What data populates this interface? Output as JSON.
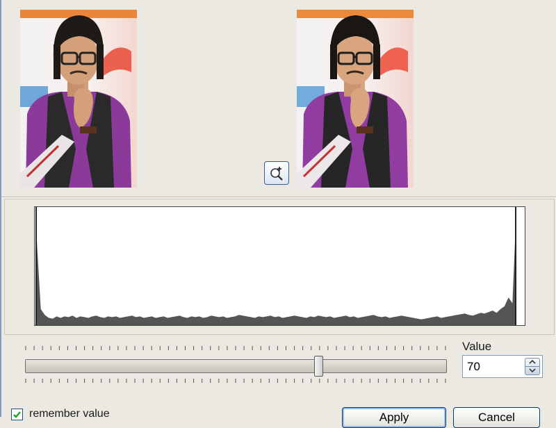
{
  "preview": {
    "before_image": "photo-person-glasses-guitar",
    "after_image": "photo-person-glasses-guitar-adjusted",
    "zoom_icon": "zoom-in-icon"
  },
  "histogram": {
    "bins": [
      115,
      22,
      14,
      10,
      9,
      12,
      10,
      12,
      11,
      13,
      10,
      12,
      11,
      10,
      12,
      13,
      11,
      10,
      12,
      11,
      12,
      10,
      11,
      12,
      13,
      11,
      12,
      10,
      11,
      12,
      10,
      11,
      12,
      10,
      11,
      12,
      13,
      11,
      10,
      12,
      11,
      12,
      10,
      11,
      13,
      12,
      11,
      12,
      10,
      11,
      12,
      14,
      13,
      12,
      11,
      10,
      12,
      11,
      12,
      13,
      11,
      12,
      10,
      11,
      12,
      13,
      12,
      11,
      10,
      12,
      11,
      13,
      12,
      11,
      12,
      10,
      11,
      12,
      13,
      11,
      12,
      10,
      11,
      12,
      13,
      14,
      12,
      11,
      12,
      10,
      11,
      12,
      13,
      12,
      11,
      10,
      9,
      8,
      9,
      10,
      11,
      12,
      10,
      11,
      12,
      13,
      14,
      15,
      16,
      14,
      13,
      15,
      17,
      16,
      18,
      20,
      17,
      22,
      26,
      38,
      30,
      160
    ]
  },
  "slider": {
    "value_fraction": 0.7
  },
  "value": {
    "label": "Value",
    "current": "70"
  },
  "remember": {
    "label": "remember value",
    "checked": true
  },
  "buttons": {
    "apply": "Apply",
    "cancel": "Cancel"
  }
}
